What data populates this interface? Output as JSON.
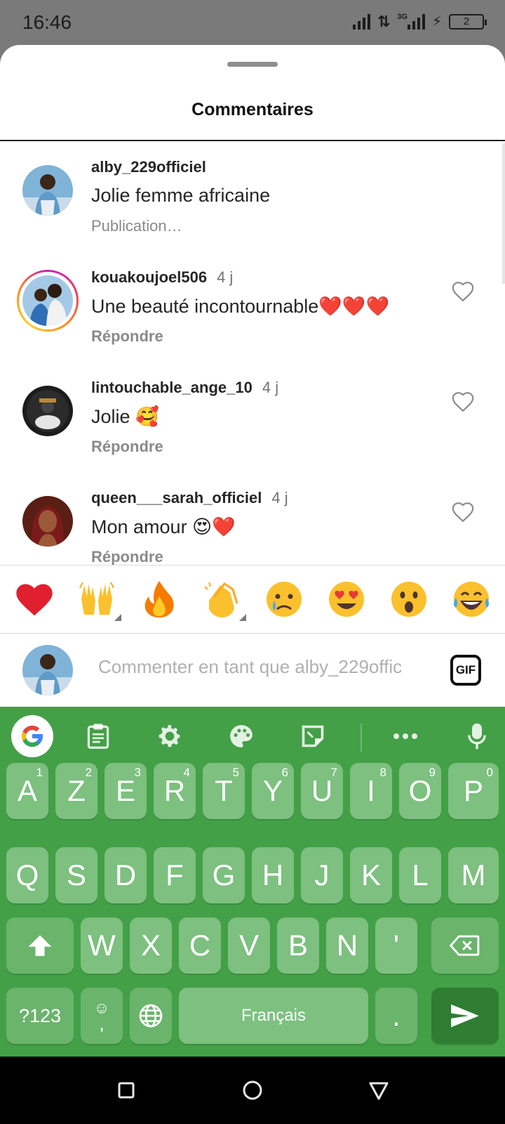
{
  "status_bar": {
    "time": "16:46",
    "network_label": "3G",
    "battery_level": "2"
  },
  "sheet": {
    "title": "Commentaires"
  },
  "comments": [
    {
      "username": "alby_229officiel",
      "time": "",
      "text": "Jolie femme africaine",
      "sub_label": "Publication…",
      "liked": false,
      "is_caption": true
    },
    {
      "username": "kouakoujoel506",
      "time": "4 j",
      "text": "Une beauté incontournable❤️❤️❤️",
      "sub_label": "Répondre",
      "has_story_ring": true
    },
    {
      "username": "lintouchable_ange_10",
      "time": "4 j",
      "text": "Jolie 🥰",
      "sub_label": "Répondre"
    },
    {
      "username": "queen___sarah_officiel",
      "time": "4 j",
      "text": "Mon amour 😍❤️",
      "sub_label": "Répondre"
    }
  ],
  "emoji_bar": [
    {
      "name": "heart",
      "glyph": "❤️"
    },
    {
      "name": "raising-hands",
      "glyph": "🙌"
    },
    {
      "name": "fire",
      "glyph": "🔥"
    },
    {
      "name": "clapping-hands",
      "glyph": "👏"
    },
    {
      "name": "crying-face",
      "glyph": "😢"
    },
    {
      "name": "heart-eyes",
      "glyph": "😍"
    },
    {
      "name": "surprised-face",
      "glyph": "😮"
    },
    {
      "name": "laughing-face",
      "glyph": "😂"
    }
  ],
  "comment_input": {
    "placeholder": "Commenter en tant que alby_229offic",
    "gif_label": "GIF"
  },
  "keyboard": {
    "row1": [
      {
        "label": "A",
        "hint": "1"
      },
      {
        "label": "Z",
        "hint": "2"
      },
      {
        "label": "E",
        "hint": "3"
      },
      {
        "label": "R",
        "hint": "4"
      },
      {
        "label": "T",
        "hint": "5"
      },
      {
        "label": "Y",
        "hint": "6"
      },
      {
        "label": "U",
        "hint": "7"
      },
      {
        "label": "I",
        "hint": "8"
      },
      {
        "label": "O",
        "hint": "9"
      },
      {
        "label": "P",
        "hint": "0"
      }
    ],
    "row2": [
      "Q",
      "S",
      "D",
      "F",
      "G",
      "H",
      "J",
      "K",
      "L",
      "M"
    ],
    "row3": [
      "W",
      "X",
      "C",
      "V",
      "B",
      "N",
      "'"
    ],
    "symbols_label": "?123",
    "emoji_key_label": ",",
    "space_label": "Français",
    "period_label": ".",
    "accent_color": "#43a047"
  }
}
